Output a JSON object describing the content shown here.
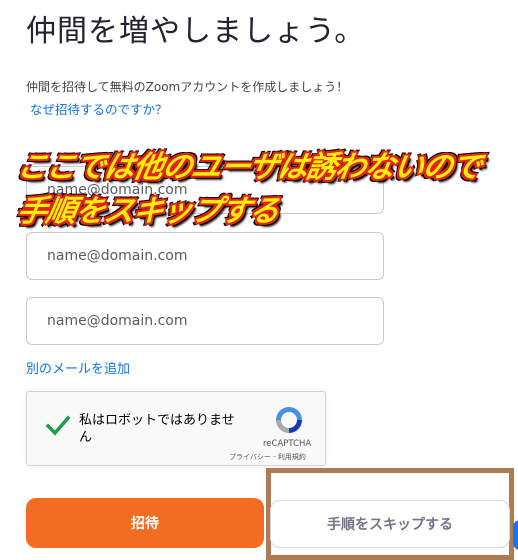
{
  "page": {
    "title": "仲間を増やしましょう。",
    "description": "仲間を招待して無料のZoomアカウントを作成しましょう！",
    "why_link": "なぜ招待するのですか？"
  },
  "emails": [
    {
      "value": "",
      "placeholder": "name@domain.com"
    },
    {
      "value": "",
      "placeholder": "name@domain.com"
    },
    {
      "value": "",
      "placeholder": "name@domain.com"
    }
  ],
  "add_email_link": "別のメールを追加",
  "recaptcha": {
    "checked": true,
    "label": "私はロボットではありません",
    "brand": "reCAPTCHA",
    "terms": "プライバシー - 利用規約"
  },
  "overlay": {
    "line1": "ここでは他のユーザは誘わないので",
    "line2": "手順をスキップする"
  },
  "buttons": {
    "invite": "招待",
    "skip": "手順をスキップする"
  },
  "colors": {
    "accent": "#f26d21",
    "link": "#0e72ed",
    "highlight_border": "#b07a54",
    "overlay_text": "#ffee00",
    "overlay_outline": "#e0241a"
  }
}
